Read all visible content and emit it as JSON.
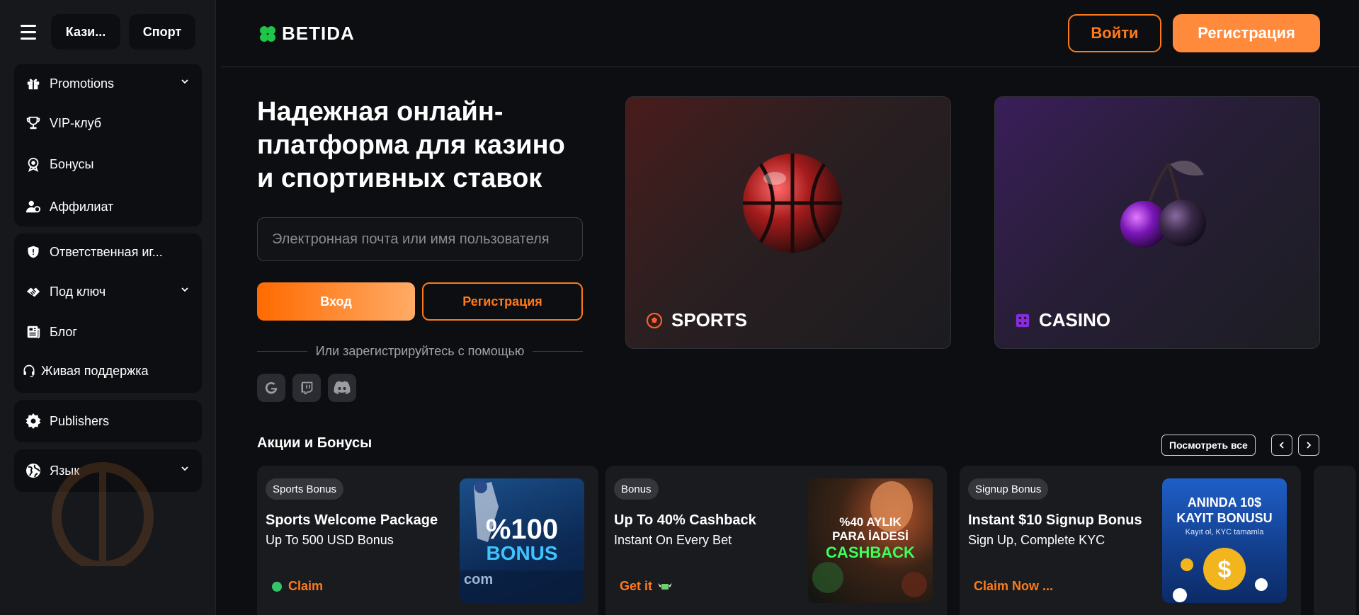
{
  "sidebar": {
    "top_tabs": [
      "Кази...",
      "Спорт"
    ],
    "group1": [
      {
        "label": "Promotions",
        "icon": "gift-icon",
        "has_chevron": true
      },
      {
        "label": "VIP-клуб",
        "icon": "trophy-icon"
      },
      {
        "label": "Бонусы",
        "icon": "badge-icon"
      },
      {
        "label": "Аффилиат",
        "icon": "affiliate-icon"
      }
    ],
    "group2": [
      {
        "label": "Ответственная иг...",
        "icon": "shield-icon"
      },
      {
        "label": "Под ключ",
        "icon": "handshake-icon",
        "has_chevron": true
      },
      {
        "label": "Блог",
        "icon": "newspaper-icon"
      },
      {
        "label": "Живая поддержка",
        "icon": "headset-icon"
      }
    ],
    "publishers": {
      "label": "Publishers",
      "icon": "gear-icon"
    },
    "language": {
      "label": "Язык",
      "icon": "globe-icon",
      "has_chevron": true
    }
  },
  "header": {
    "logo_text": "BETIDA",
    "login_label": "Войти",
    "register_label": "Регистрация"
  },
  "hero": {
    "title": "Надежная онлайн-платформа для казино и спортивных ставок",
    "input_placeholder": "Электронная почта или имя пользователя",
    "enter_label": "Вход",
    "register_label": "Регистрация",
    "or_text": "Или зарегистрируйтесь с помощью",
    "socials": [
      "google-icon",
      "twitch-icon",
      "discord-icon"
    ]
  },
  "categories": [
    {
      "label": "SPORTS",
      "icon": "football-icon",
      "color": "#ff5a2a"
    },
    {
      "label": "CASINO",
      "icon": "dice-icon",
      "color": "#8a2be2"
    }
  ],
  "promotions": {
    "title": "Акции и Бонусы",
    "see_all_label": "Посмотреть все",
    "items": [
      {
        "badge": "Sports Bonus",
        "title": "Sports Welcome Package",
        "subtitle": "Up To 500 USD Bonus",
        "cta": "Claim",
        "image_text": [
          "%100",
          "BONUS",
          "com"
        ]
      },
      {
        "badge": "Bonus",
        "title": "Up To 40% Cashback",
        "subtitle": "Instant On Every Bet",
        "cta": "Get it",
        "image_text": [
          "%40 AYLIK",
          "PARA İADESİ",
          "CASHBACK"
        ]
      },
      {
        "badge": "Signup Bonus",
        "title": "Instant $10 Signup Bonus",
        "subtitle": "Sign Up, Complete KYC",
        "cta": "Claim Now ...",
        "image_text": [
          "ANINDA 10$",
          "KAYIT BONUSU",
          "Kayıt ol, KYC tamamla"
        ]
      }
    ]
  },
  "colors": {
    "accent": "#ff7a1a",
    "accent_fill": "#ff8a3c",
    "background": "#0d0e12",
    "sidebar": "#17181c"
  }
}
